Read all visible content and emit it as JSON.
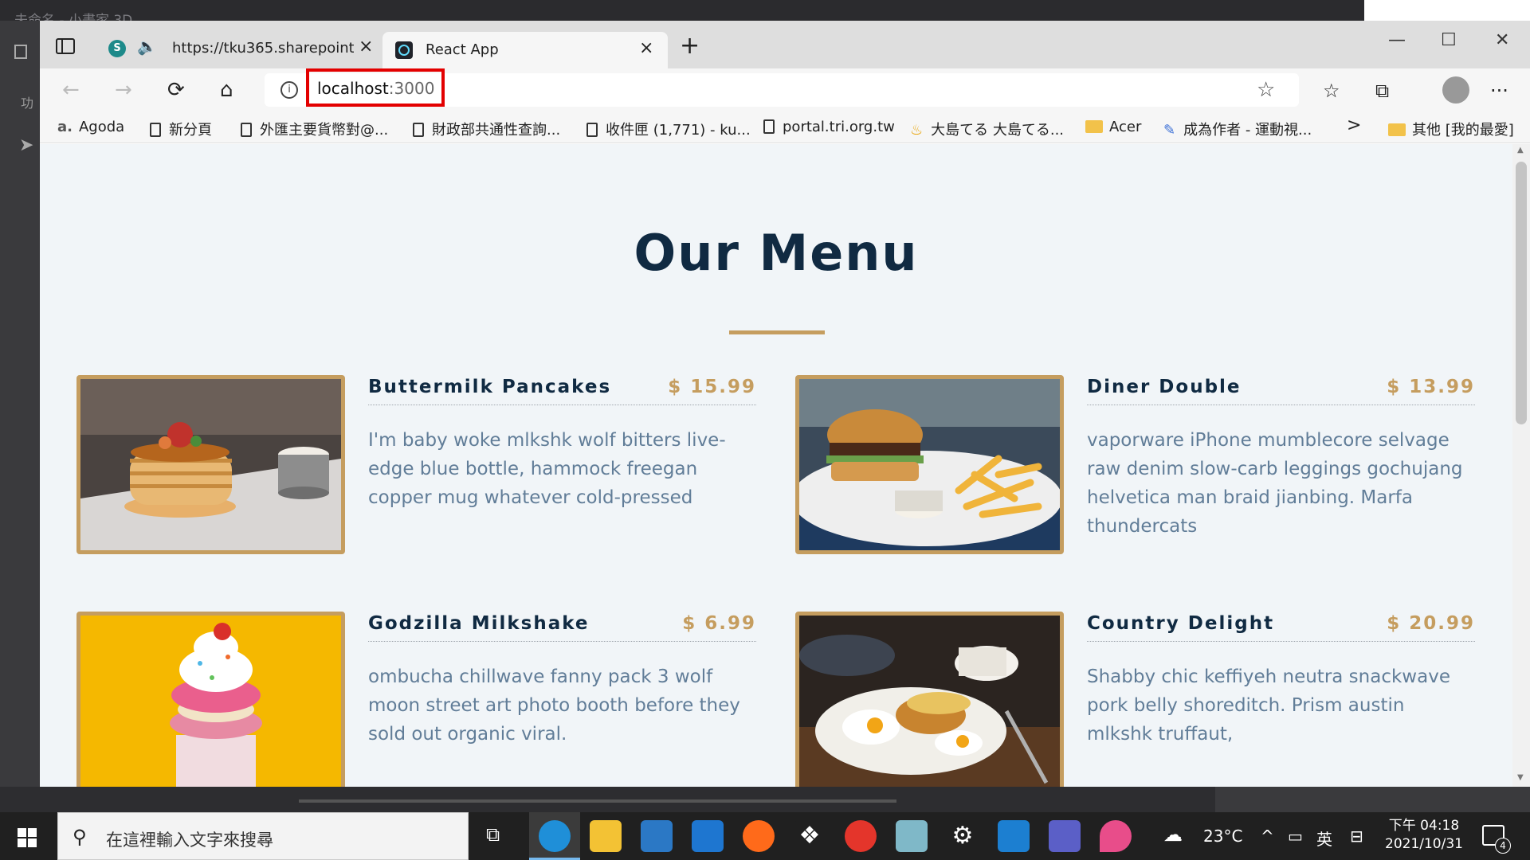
{
  "background_app": {
    "title": "未命名 - 小畫家 3D",
    "side_label": "功"
  },
  "browser": {
    "tabs": [
      {
        "label": "https://tku365.sharepoint.com",
        "close": "×"
      },
      {
        "label": "React App",
        "close": "×"
      }
    ],
    "new_tab": "+",
    "window_controls": {
      "minimize": "—",
      "maximize": "☐",
      "close": "✕"
    },
    "nav": {
      "back": "←",
      "forward": "→",
      "reload": "⟳",
      "home": "⌂"
    },
    "address": {
      "host": "localhost",
      "port": ":3000",
      "info_glyph": "i"
    },
    "toolbar_icons": {
      "favorites": "☆",
      "collections": "⧉",
      "more": "···"
    },
    "bookmarks": [
      {
        "label": "Agoda",
        "kind": "site",
        "prefix": "a."
      },
      {
        "label": "新分頁",
        "kind": "page"
      },
      {
        "label": "外匯主要貨幣對@...",
        "kind": "page"
      },
      {
        "label": "財政部共通性查詢...",
        "kind": "page"
      },
      {
        "label": "收件匣 (1,771) - ku...",
        "kind": "page"
      },
      {
        "label": "portal.tri.org.tw",
        "kind": "page"
      },
      {
        "label": "大島てる 大島てる...",
        "kind": "site"
      },
      {
        "label": "Acer",
        "kind": "folder"
      },
      {
        "label": "成為作者 - 運動視...",
        "kind": "site"
      }
    ],
    "bookmarks_more": ">",
    "other_favorites": "其他 [我的最愛]"
  },
  "page": {
    "title": "Our Menu",
    "accent": "#c59d5f",
    "heading_color": "#102a42",
    "items": [
      {
        "name": "Buttermilk Pancakes",
        "price": "$ 15.99",
        "desc": "I'm baby woke mlkshk wolf bitters live-edge blue bottle, hammock freegan copper mug whatever cold-pressed"
      },
      {
        "name": "Diner Double",
        "price": "$ 13.99",
        "desc": "vaporware iPhone mumblecore selvage raw denim slow-carb leggings gochujang helvetica man braid jianbing. Marfa thundercats"
      },
      {
        "name": "Godzilla Milkshake",
        "price": "$ 6.99",
        "desc": "ombucha chillwave fanny pack 3 wolf moon street art photo booth before they sold out organic viral."
      },
      {
        "name": "Country Delight",
        "price": "$ 20.99",
        "desc": "Shabby chic keffiyeh neutra snackwave pork belly shoreditch. Prism austin mlkshk truffaut,"
      }
    ]
  },
  "taskbar": {
    "search_placeholder": "在這裡輸入文字來搜尋",
    "weather": "23°C",
    "ime": "英",
    "time": "下午 04:18",
    "date": "2021/10/31",
    "notifications": "4"
  }
}
